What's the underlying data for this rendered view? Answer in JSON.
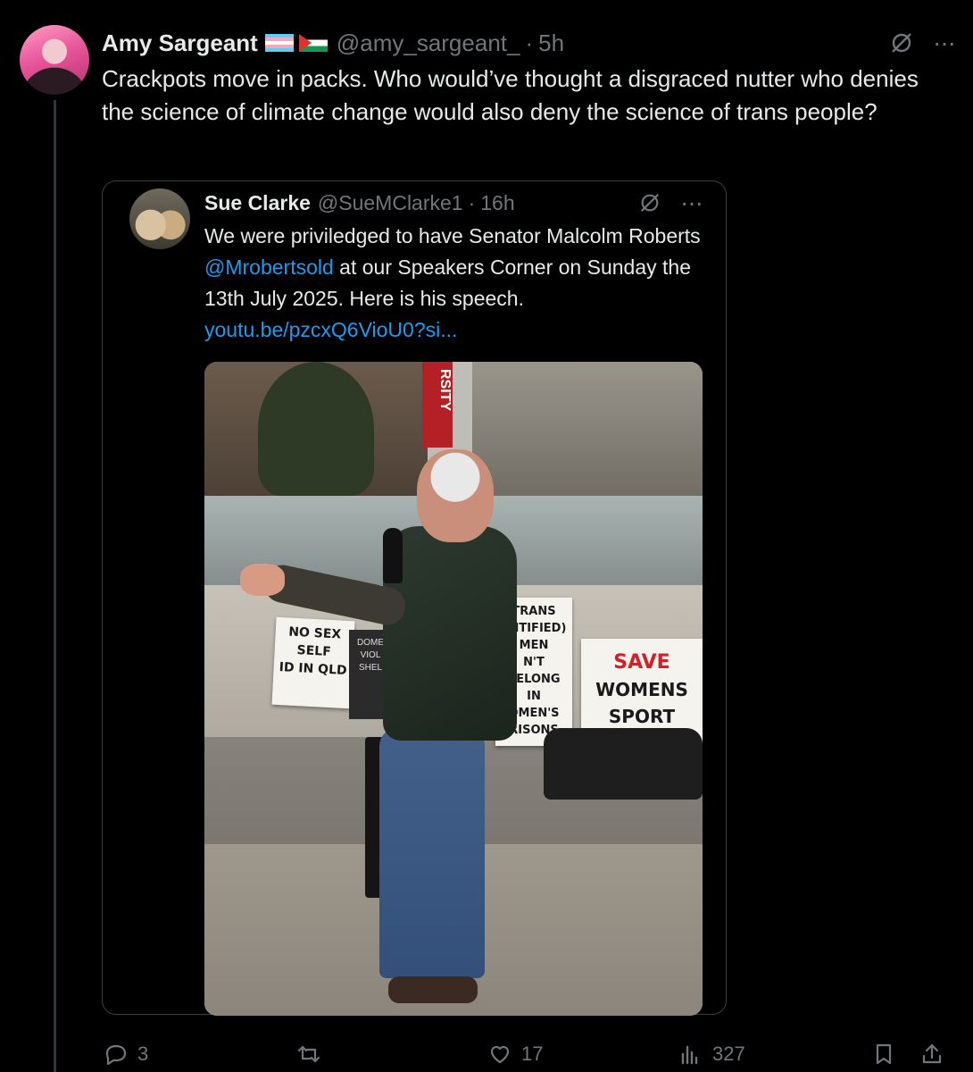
{
  "post": {
    "author_name": "Amy Sargeant",
    "flags": [
      "trans-flag",
      "palestine-flag"
    ],
    "handle": "@amy_sargeant_",
    "separator": "·",
    "time": "5h",
    "text": "Crackpots move in packs. Who would’ve thought a disgraced nutter who denies the science of climate change would also deny the science of trans people?",
    "more_label": "···"
  },
  "quote": {
    "author_name": "Sue Clarke",
    "handle": "@SueMClarke1",
    "separator": "·",
    "time": "16h",
    "text_1": "We were priviledged to have Senator Malcolm Roberts ",
    "mention": "@Mrobertsold",
    "text_2": " at our Speakers Corner on Sunday the 13th July 2025.   Here is his speech. ",
    "link": "youtu.be/pzcxQ6VioU0?si...",
    "more_label": "···",
    "media": {
      "banner_text": "RSITY",
      "sign_1": "NO SEX\nSELF\nID IN QLD",
      "dark_sign": "DOME\nVIOL\nSHEL",
      "sign_2": "TRANS\nENTIFIED)\nMEN\nN'T BELONG\nIN\nOMEN'S\nRISONS",
      "sign_3_red": "SAVE",
      "sign_3": "WOMENS\nSPORT"
    }
  },
  "actions": {
    "replies": "3",
    "retweets": "",
    "likes": "17",
    "views": "327"
  },
  "colors": {
    "background": "#000000",
    "text": "#e7e9ea",
    "muted": "#71767b",
    "link": "#1d9bf0",
    "border": "#3a3d41"
  }
}
